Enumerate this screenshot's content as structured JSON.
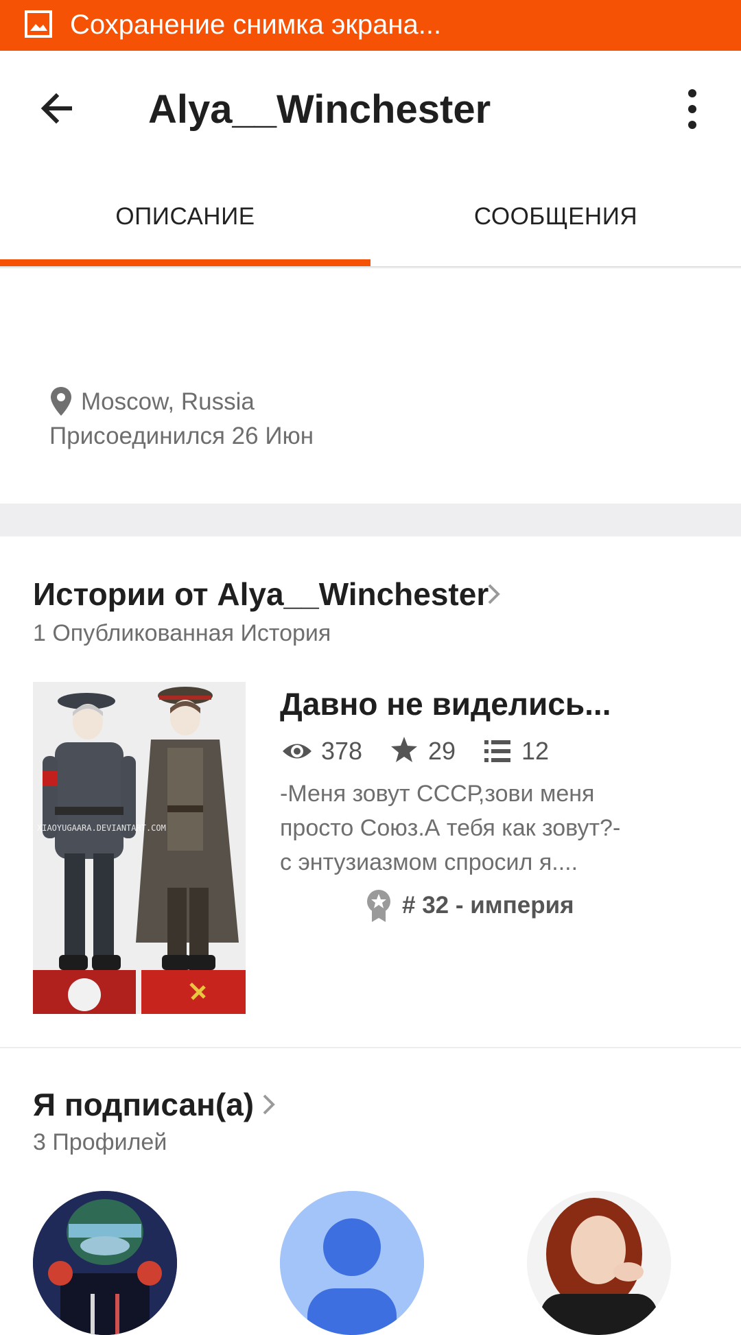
{
  "status_bar": {
    "text": "Сохранение снимка экрана..."
  },
  "app_bar": {
    "title": "Alya__Winchester"
  },
  "tabs": [
    {
      "label": "ОПИСАНИЕ",
      "active": true
    },
    {
      "label": "СООБЩЕНИЯ",
      "active": false
    }
  ],
  "profile": {
    "location": "Moscow, Russia",
    "joined": "Присоединился 26 Июн"
  },
  "stories": {
    "title": "Истории от Alya__Winchester",
    "subtitle": "1 Опубликованная История",
    "items": [
      {
        "title": "Давно не виделись...",
        "views": "378",
        "votes": "29",
        "parts": "12",
        "description_lines": [
          "-Меня зовут СССР,зови меня",
          "просто Союз.А тебя как зовут?-",
          "с энтузиазмом спросил я...."
        ],
        "rank": "# 32 - империя",
        "cover_watermark": "XIAOYUGAARA.DEVIANTART.COM"
      }
    ]
  },
  "following": {
    "title": "Я подписан(а)",
    "subtitle": "3 Профилей"
  },
  "colors": {
    "accent": "#f55206",
    "divider": "#eeeef1",
    "secondary_text": "#6e6e6e"
  },
  "icons": [
    "image-icon",
    "back-arrow-icon",
    "more-vert-icon",
    "location-pin-icon",
    "chevron-right-icon",
    "eye-icon",
    "star-icon",
    "list-icon",
    "ribbon-icon"
  ]
}
